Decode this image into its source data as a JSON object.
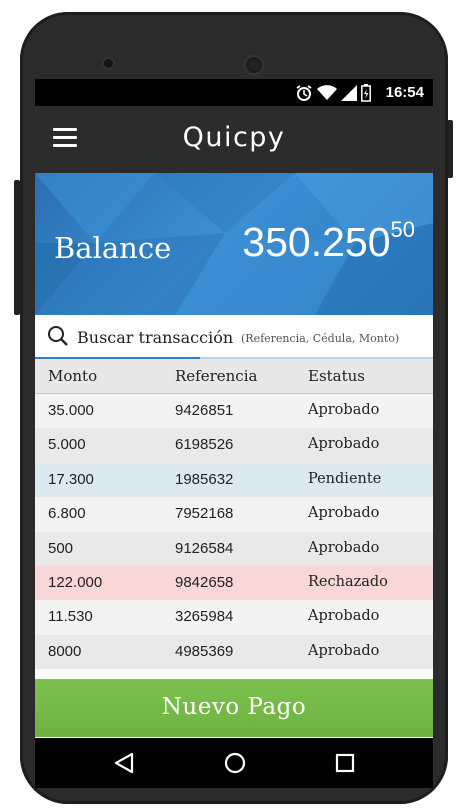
{
  "status_bar": {
    "time": "16:54",
    "icons": [
      "alarm-icon",
      "wifi-icon",
      "signal-icon",
      "battery-icon"
    ]
  },
  "app_bar": {
    "title": "Quicpy",
    "menu_icon": "menu-icon"
  },
  "balance": {
    "label": "Balance",
    "integer": "350.250",
    "cents": "50"
  },
  "search": {
    "label": "Buscar transacción",
    "hint": "(Referencia, Cédula, Monto)"
  },
  "table": {
    "headers": [
      "Monto",
      "Referencia",
      "Estatus"
    ],
    "rows": [
      {
        "monto": "35.000",
        "referencia": "9426851",
        "estatus": "Aprobado",
        "bg": "#f3f3f3"
      },
      {
        "monto": "5.000",
        "referencia": "6198526",
        "estatus": "Aprobado",
        "bg": "#e9e9e9"
      },
      {
        "monto": "17.300",
        "referencia": "1985632",
        "estatus": "Pendiente",
        "bg": "#dce9f1"
      },
      {
        "monto": "6.800",
        "referencia": "7952168",
        "estatus": "Aprobado",
        "bg": "#f3f3f3"
      },
      {
        "monto": "500",
        "referencia": "9126584",
        "estatus": "Aprobado",
        "bg": "#e9e9e9"
      },
      {
        "monto": "122.000",
        "referencia": "9842658",
        "estatus": "Rechazado",
        "bg": "#f9d7d7"
      },
      {
        "monto": "11.530",
        "referencia": "3265984",
        "estatus": "Aprobado",
        "bg": "#f3f3f3"
      },
      {
        "monto": "8000",
        "referencia": "4985369",
        "estatus": "Aprobado",
        "bg": "#e9e9e9"
      }
    ]
  },
  "cta": {
    "label": "Nuevo Pago",
    "color": "#74b847"
  },
  "nav_bar": {
    "buttons": [
      "back-icon",
      "home-icon",
      "recents-icon"
    ]
  },
  "colors": {
    "hero": "#3286c8",
    "app_bar": "#2c2c2c",
    "accent": "#2f7fd0"
  }
}
